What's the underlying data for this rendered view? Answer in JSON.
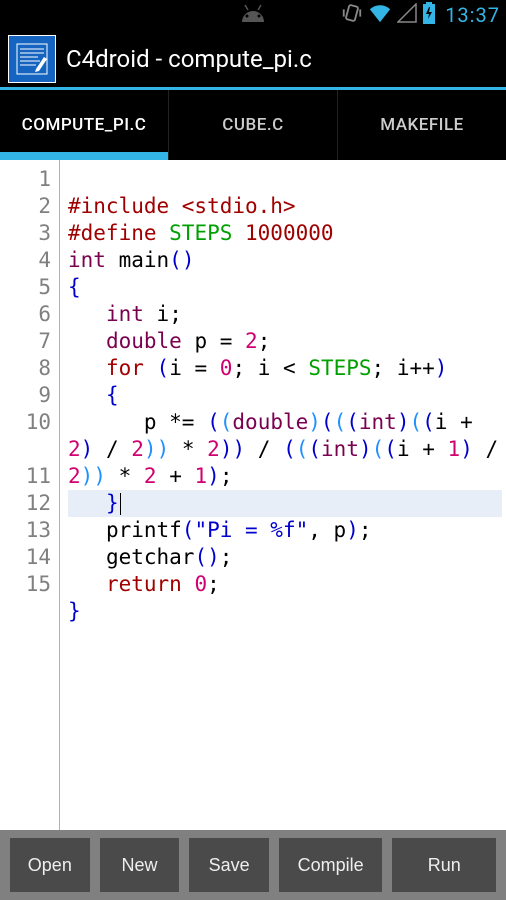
{
  "status": {
    "clock": "13:37"
  },
  "header": {
    "title": "C4droid - compute_pi.c"
  },
  "tabs": [
    {
      "label": "COMPUTE_PI.C",
      "active": true
    },
    {
      "label": "CUBE.C",
      "active": false
    },
    {
      "label": "MAKEFILE",
      "active": false
    }
  ],
  "editor": {
    "line_numbers": [
      "1",
      "2",
      "3",
      "4",
      "5",
      "6",
      "7",
      "8",
      "9",
      "10",
      "11",
      "12",
      "13",
      "14",
      "15"
    ],
    "code_plain": [
      "",
      "#include <stdio.h>",
      "#define STEPS 1000000",
      "int main()",
      "{",
      "   int i;",
      "   double p = 2;",
      "   for (i = 0; i < STEPS; i++)",
      "   {",
      "      p *= ((double)(((int)((i + 2) / 2)) * 2)) / (((int)((i + 1) / 2)) * 2 + 1);",
      "   }",
      "   printf(\"Pi = %f\", p);",
      "   getchar();",
      "   return 0;",
      "}"
    ],
    "highlighted_line": 11
  },
  "toolbar": {
    "open": "Open",
    "new": "New",
    "save": "Save",
    "compile": "Compile",
    "run": "Run"
  }
}
